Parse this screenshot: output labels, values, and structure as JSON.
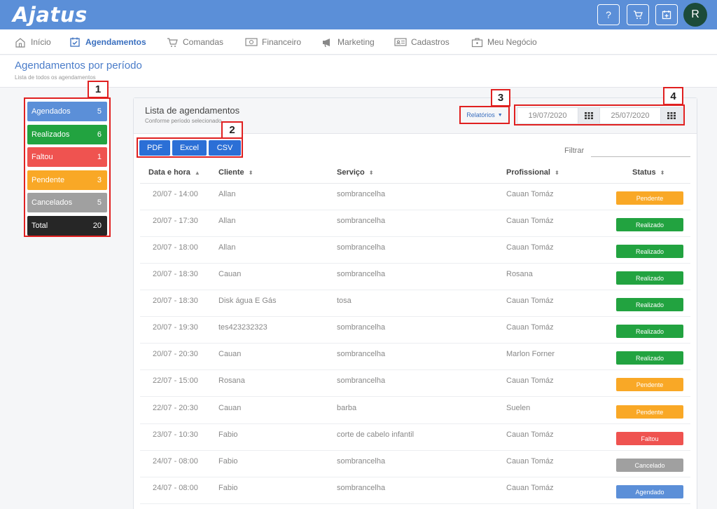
{
  "app": {
    "logo": "Ajatus",
    "avatar_initial": "R"
  },
  "topbar": {
    "help": "?",
    "cart": "🛒",
    "calendar": "📅"
  },
  "nav": [
    {
      "label": "Início",
      "icon": "home-icon"
    },
    {
      "label": "Agendamentos",
      "icon": "calendar-check-icon"
    },
    {
      "label": "Comandas",
      "icon": "cart-icon"
    },
    {
      "label": "Financeiro",
      "icon": "money-icon"
    },
    {
      "label": "Marketing",
      "icon": "megaphone-icon"
    },
    {
      "label": "Cadastros",
      "icon": "id-card-icon"
    },
    {
      "label": "Meu Negócio",
      "icon": "briefcase-icon"
    }
  ],
  "page": {
    "title": "Agendamentos por período",
    "subtitle": "Lista de todos os agendamentos"
  },
  "stats": [
    {
      "label": "Agendados",
      "count": "5",
      "color": "#5b8fd8"
    },
    {
      "label": "Realizados",
      "count": "6",
      "color": "#22a340"
    },
    {
      "label": "Faltou",
      "count": "1",
      "color": "#ef5350"
    },
    {
      "label": "Pendente",
      "count": "3",
      "color": "#f9a826"
    },
    {
      "label": "Cancelados",
      "count": "5",
      "color": "#a0a0a0"
    },
    {
      "label": "Total",
      "count": "20",
      "color": "#262626"
    }
  ],
  "markers": [
    "1",
    "2",
    "3",
    "4"
  ],
  "card": {
    "title": "Lista de agendamentos",
    "subtitle": "Conforme período selecionado"
  },
  "export": {
    "pdf": "PDF",
    "excel": "Excel",
    "csv": "CSV"
  },
  "reports": {
    "label": "Relatórios"
  },
  "dates": {
    "start": "19/07/2020",
    "end": "25/07/2020"
  },
  "filter": {
    "label": "Filtrar",
    "value": ""
  },
  "columns": [
    "Data e hora",
    "Cliente",
    "Serviço",
    "Profissional",
    "Status"
  ],
  "status_colors": {
    "Pendente": "#f9a826",
    "Realizado": "#22a340",
    "Faltou": "#ef5350",
    "Cancelado": "#a0a0a0",
    "Agendado": "#5b8fd8"
  },
  "rows": [
    {
      "datetime": "20/07 - 14:00",
      "client": "Allan",
      "service": "sombrancelha",
      "professional": "Cauan Tomáz",
      "status": "Pendente"
    },
    {
      "datetime": "20/07 - 17:30",
      "client": "Allan",
      "service": "sombrancelha",
      "professional": "Cauan Tomáz",
      "status": "Realizado"
    },
    {
      "datetime": "20/07 - 18:00",
      "client": "Allan",
      "service": "sombrancelha",
      "professional": "Cauan Tomáz",
      "status": "Realizado"
    },
    {
      "datetime": "20/07 - 18:30",
      "client": "Cauan",
      "service": "sombrancelha",
      "professional": "Rosana",
      "status": "Realizado"
    },
    {
      "datetime": "20/07 - 18:30",
      "client": "Disk água E Gás",
      "service": "tosa",
      "professional": "Cauan Tomáz",
      "status": "Realizado"
    },
    {
      "datetime": "20/07 - 19:30",
      "client": "tes423232323",
      "service": "sombrancelha",
      "professional": "Cauan Tomáz",
      "status": "Realizado"
    },
    {
      "datetime": "20/07 - 20:30",
      "client": "Cauan",
      "service": "sombrancelha",
      "professional": "Marlon Forner",
      "status": "Realizado"
    },
    {
      "datetime": "22/07 - 15:00",
      "client": "Rosana",
      "service": "sombrancelha",
      "professional": "Cauan Tomáz",
      "status": "Pendente"
    },
    {
      "datetime": "22/07 - 20:30",
      "client": "Cauan",
      "service": "barba",
      "professional": "Suelen",
      "status": "Pendente"
    },
    {
      "datetime": "23/07 - 10:30",
      "client": "Fabio",
      "service": "corte de cabelo infantil",
      "professional": "Cauan Tomáz",
      "status": "Faltou"
    },
    {
      "datetime": "24/07 - 08:00",
      "client": "Fabio",
      "service": "sombrancelha",
      "professional": "Cauan Tomáz",
      "status": "Cancelado"
    },
    {
      "datetime": "24/07 - 08:00",
      "client": "Fabio",
      "service": "sombrancelha",
      "professional": "Cauan Tomáz",
      "status": "Agendado"
    }
  ]
}
